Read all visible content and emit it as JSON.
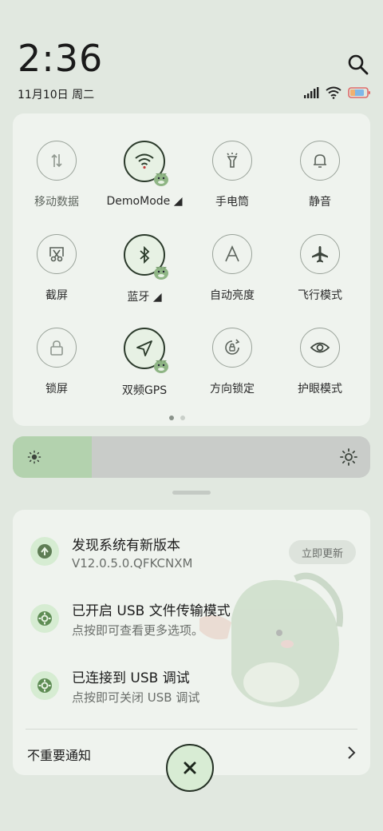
{
  "status_bar": {
    "time": "2:36",
    "date": "11月10日 周二",
    "battery_level": 0.85
  },
  "icons": {
    "search": "search-icon",
    "signal": "signal-icon",
    "wifi": "wifi-icon",
    "battery": "battery-icon"
  },
  "tiles": [
    {
      "label": "移动数据",
      "active": false,
      "icon": "mobile-data-icon"
    },
    {
      "label": "DemoMode ◢",
      "active": true,
      "icon": "wifi-icon"
    },
    {
      "label": "手电筒",
      "active": false,
      "icon": "flashlight-icon"
    },
    {
      "label": "静音",
      "active": false,
      "icon": "bell-icon"
    },
    {
      "label": "截屏",
      "active": false,
      "icon": "screenshot-icon"
    },
    {
      "label": "蓝牙 ◢",
      "active": true,
      "icon": "bluetooth-icon"
    },
    {
      "label": "自动亮度",
      "active": false,
      "icon": "auto-brightness-icon"
    },
    {
      "label": "飞行模式",
      "active": false,
      "icon": "airplane-icon"
    },
    {
      "label": "锁屏",
      "active": false,
      "icon": "lock-icon"
    },
    {
      "label": "双频GPS",
      "active": true,
      "icon": "location-arrow-icon"
    },
    {
      "label": "方向锁定",
      "active": false,
      "icon": "rotation-lock-icon"
    },
    {
      "label": "护眼模式",
      "active": false,
      "icon": "eye-icon"
    }
  ],
  "pager": {
    "current": 1,
    "total": 2
  },
  "brightness": {
    "level": 0.22
  },
  "notifications": [
    {
      "title": "发现系统有新版本",
      "subtitle": "V12.0.5.0.QFKCNXM",
      "action": "立即更新",
      "icon": "update-icon"
    },
    {
      "title": "已开启 USB 文件传输模式",
      "subtitle": "点按即可查看更多选项。",
      "icon": "settings-gear-icon"
    },
    {
      "title": "已连接到 USB 调试",
      "subtitle": "点按即可关闭 USB 调试",
      "icon": "settings-gear-icon"
    }
  ],
  "footer": {
    "label": "不重要通知"
  },
  "colors": {
    "accent": "#b3d2ae",
    "panel": "#eff3ee",
    "background": "#e1e8e0"
  }
}
